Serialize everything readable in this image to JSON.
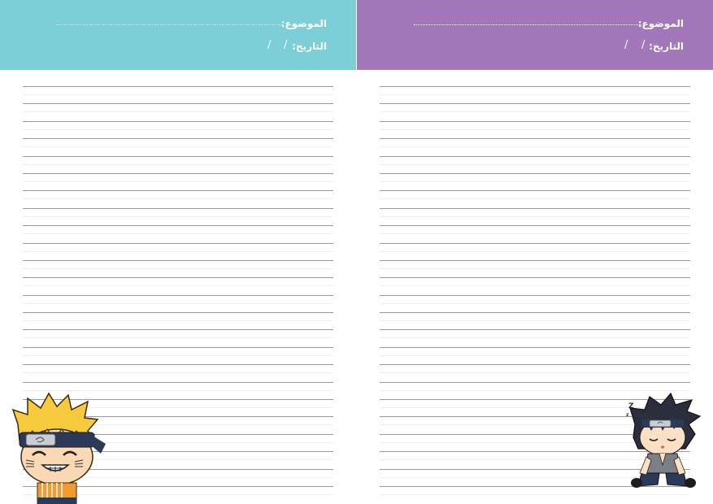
{
  "left_page": {
    "subject_label": "الموضوع:",
    "date_label": "التاريخ:",
    "date_slashes": [
      "/",
      "/"
    ],
    "header_color": "#7ccfd6"
  },
  "right_page": {
    "subject_label": "الموضوع:",
    "date_label": "التاريخ:",
    "date_slashes": [
      "/",
      "/"
    ],
    "header_color": "#a278bb",
    "sleep_marks": [
      "Z",
      "z"
    ]
  },
  "ruled_lines_per_page": 24
}
